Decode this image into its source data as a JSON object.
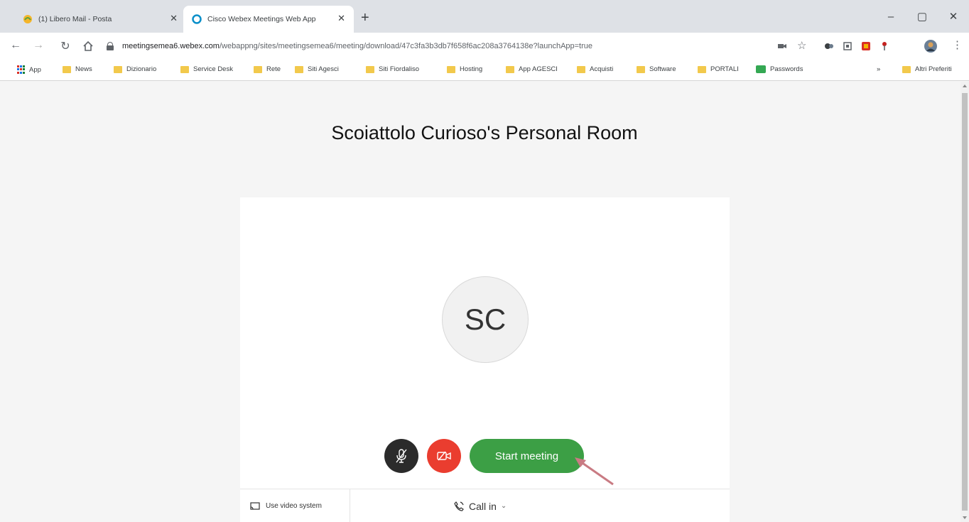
{
  "browser": {
    "tabs": [
      {
        "title": "(1) Libero Mail - Posta",
        "active": false
      },
      {
        "title": "Cisco Webex Meetings Web App",
        "active": true
      }
    ],
    "new_tab_label": "+",
    "window_controls": {
      "minimize": "–",
      "maximize": "▢",
      "close": "✕"
    },
    "url": {
      "domain": "meetingsemea6.webex.com",
      "path": "/webappng/sites/meetingsemea6/meeting/download/47c3fa3b3db7f658f6ac208a3764138e?launchApp=true"
    },
    "bookmarks": [
      "App",
      "News",
      "Dizionario",
      "Service Desk",
      "Rete",
      "Siti Agesci",
      "Siti Fiordaliso",
      "Hosting",
      "App AGESCI",
      "Acquisti",
      "Software",
      "PORTALI",
      "Passwords"
    ],
    "bookmarks_overflow": "»",
    "other_bookmarks": "Altri Preferiti"
  },
  "meeting": {
    "room_title": "Scoiattolo Curioso's Personal Room",
    "avatar_initials": "SC",
    "start_button": "Start meeting",
    "use_video_system": "Use video system",
    "call_in": "Call in",
    "colors": {
      "start": "#3c9f45",
      "video_off": "#ea3d2f",
      "mute": "#2b2b2b"
    }
  }
}
